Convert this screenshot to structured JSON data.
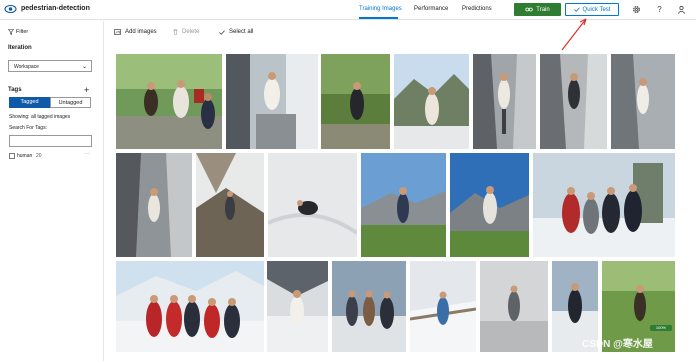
{
  "header": {
    "project_name": "pedestrian-detection",
    "tabs": [
      {
        "label": "Training Images",
        "active": true
      },
      {
        "label": "Performance",
        "active": false
      },
      {
        "label": "Predictions",
        "active": false
      }
    ],
    "train_label": "Train",
    "quick_test_label": "Quick Test",
    "accent_color": "#0078d4",
    "train_color": "#2e7d32"
  },
  "sidebar": {
    "filter_label": "Filter",
    "iteration_heading": "Iteration",
    "iteration_value": "Workspace",
    "tags_heading": "Tags",
    "tagged_label": "Tagged",
    "untagged_label": "Untagged",
    "showing_text": "Showing: all tagged images",
    "search_label": "Search For Tags:",
    "search_value": "",
    "tag_items": [
      {
        "name": "human",
        "count": "20"
      }
    ]
  },
  "toolbar": {
    "add_images": "Add images",
    "delete": "Delete",
    "select_all": "Select all"
  },
  "images": {
    "count": 20
  },
  "overlay": {
    "badge": "100%",
    "watermark": "CSDN @寒水屋"
  }
}
